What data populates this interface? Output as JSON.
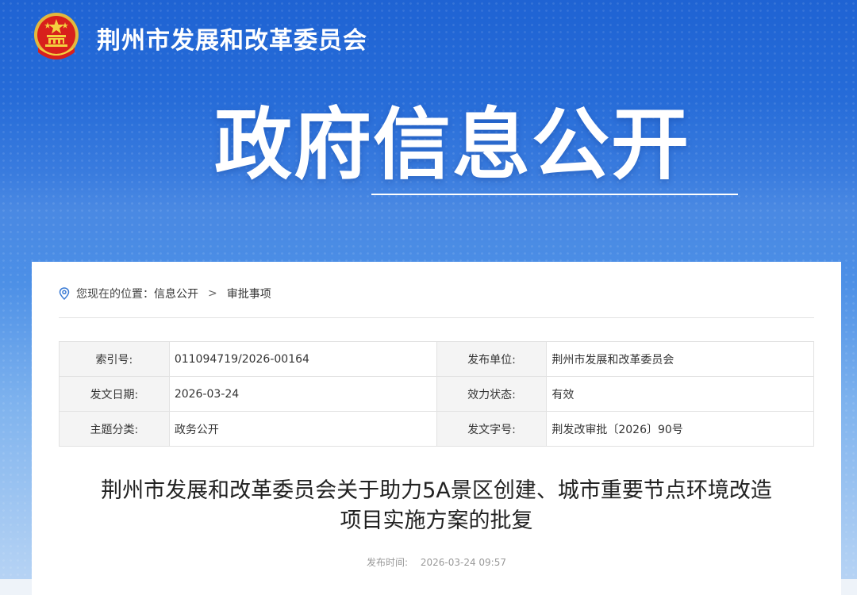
{
  "header": {
    "org_name": "荆州市发展和改革委员会",
    "hero_title": "政府信息公开"
  },
  "breadcrumb": {
    "prefix": "您现在的位置：",
    "items": [
      "信息公开",
      "审批事项"
    ],
    "separator": ">"
  },
  "metadata": [
    {
      "label": "索引号:",
      "value": "011094719/2026-00164",
      "label2": "发布单位:",
      "value2": "荆州市发展和改革委员会"
    },
    {
      "label": "发文日期:",
      "value": "2026-03-24",
      "label2": "效力状态:",
      "value2": "有效"
    },
    {
      "label": "主题分类:",
      "value": "政务公开",
      "label2": "发文字号:",
      "value2": "荆发改审批〔2026〕90号"
    }
  ],
  "document": {
    "title_line1": "荆州市发展和改革委员会关于助力5A景区创建、城市重要节点环境改造",
    "title_line2": "项目实施方案的批复",
    "publish_label": "发布时间:",
    "publish_time": "2026-03-24 09:57"
  },
  "colors": {
    "banner_top": "#1f63d3",
    "banner_bottom": "#b6d3f4",
    "accent_blue": "#3a7bd5"
  },
  "icons": {
    "emblem": "national-emblem",
    "location": "location-pin-icon"
  }
}
